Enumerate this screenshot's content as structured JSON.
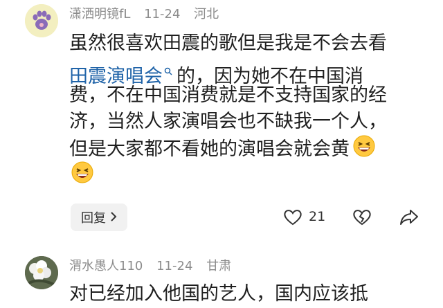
{
  "comments": [
    {
      "username": "潇洒明镜fL",
      "date": "11-24",
      "location": "河北",
      "lines": {
        "l1": "虽然很喜欢田震的歌但是我是不会去看",
        "l2_link": "田震演唱会",
        "l2_rest": "的，因为她不在中国消",
        "l3": "费，不在中国消费就是不支持国家的经",
        "l4": "济，当然人家演唱会也不缺我一个人，",
        "l5": "但是大家都不看她的演唱会就会黄"
      },
      "reply_label": "回复",
      "like_count": "21"
    },
    {
      "username": "渭水愚人110",
      "date": "11-24",
      "location": "甘肃",
      "text": "对已经加入他国的艺人，国内应该抵"
    }
  ],
  "icons": {
    "search": "search-icon",
    "emoji": "grinning-squinting-face-emoji",
    "like": "heart-icon",
    "dislike": "broken-heart-icon",
    "share": "share-arrow-icon",
    "chevron": "chevron-right-icon"
  },
  "colors": {
    "link": "#1f63a8",
    "meta": "#8c8c8c",
    "text": "#1f1f1f",
    "reply_bg": "#f1f1f1"
  }
}
